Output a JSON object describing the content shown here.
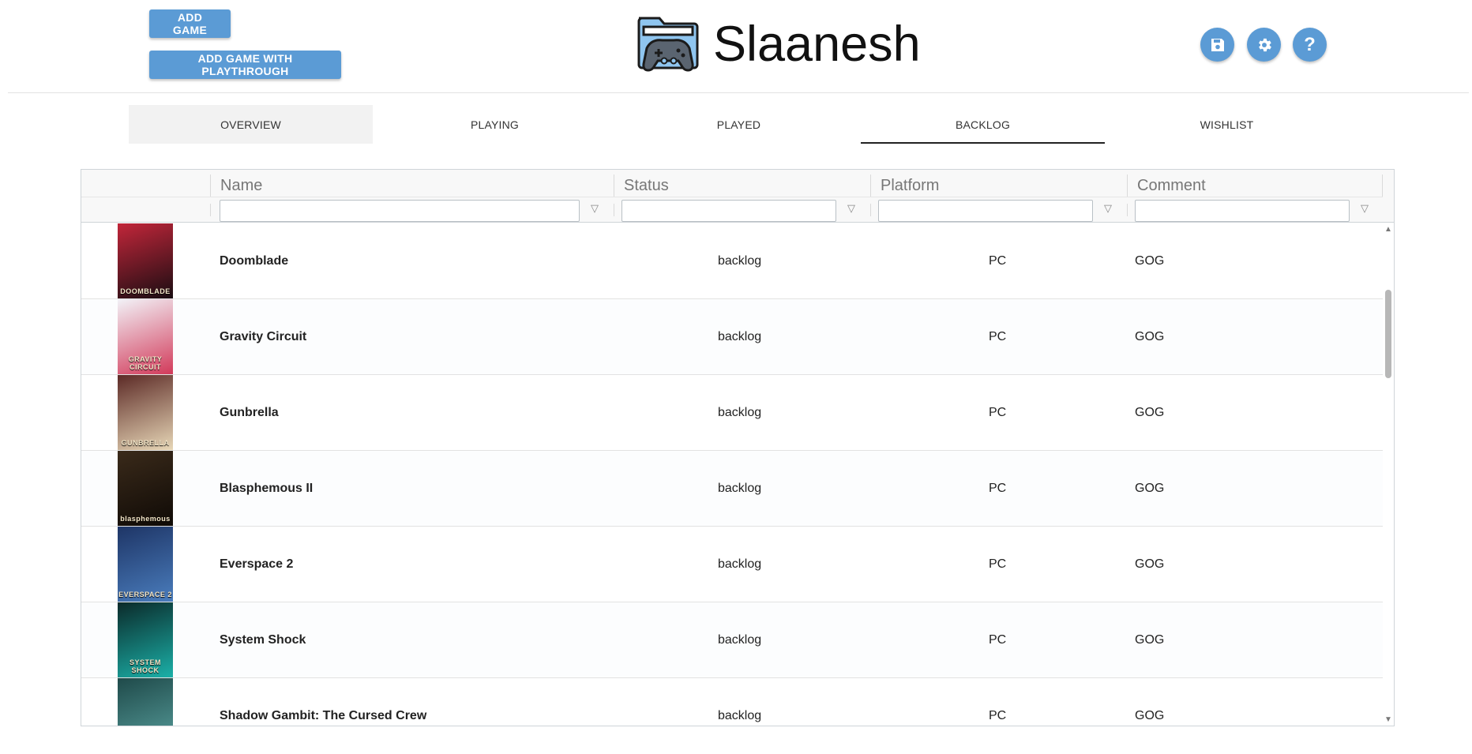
{
  "toolbar": {
    "add_game_label": "ADD GAME",
    "add_game_playthrough_label": "ADD GAME WITH PLAYTHROUGH"
  },
  "brand": {
    "title": "Slaanesh",
    "logo_icon": "folder-gamepad-icon"
  },
  "actions": {
    "save_icon": "save-icon",
    "settings_icon": "gear-icon",
    "help_label": "?"
  },
  "tabs": [
    {
      "label": "OVERVIEW"
    },
    {
      "label": "PLAYING"
    },
    {
      "label": "PLAYED"
    },
    {
      "label": "BACKLOG",
      "selected": true
    },
    {
      "label": "WISHLIST"
    }
  ],
  "grid": {
    "columns": [
      "Name",
      "Status",
      "Platform",
      "Comment"
    ],
    "rows": [
      {
        "name": "Doomblade",
        "status": "backlog",
        "platform": "PC",
        "comment": "GOG",
        "cover_colors": [
          "#c2263a",
          "#1a0d12"
        ],
        "cover_text": "DOOMBLADE"
      },
      {
        "name": "Gravity Circuit",
        "status": "backlog",
        "platform": "PC",
        "comment": "GOG",
        "cover_colors": [
          "#f2f2f7",
          "#d23a5a"
        ],
        "cover_text": "GRAVITY CIRCUIT"
      },
      {
        "name": "Gunbrella",
        "status": "backlog",
        "platform": "PC",
        "comment": "GOG",
        "cover_colors": [
          "#5c2a26",
          "#e7d7b7"
        ],
        "cover_text": "GUNBRELLA"
      },
      {
        "name": "Blasphemous II",
        "status": "backlog",
        "platform": "PC",
        "comment": "GOG",
        "cover_colors": [
          "#3a2a1a",
          "#0f0a06"
        ],
        "cover_text": "blasphemous"
      },
      {
        "name": "Everspace 2",
        "status": "backlog",
        "platform": "PC",
        "comment": "GOG",
        "cover_colors": [
          "#1e3566",
          "#4a7dbd"
        ],
        "cover_text": "EVERSPACE 2"
      },
      {
        "name": "System Shock",
        "status": "backlog",
        "platform": "PC",
        "comment": "GOG",
        "cover_colors": [
          "#0b2a2a",
          "#1bb0a8"
        ],
        "cover_text": "SYSTEM SHOCK"
      },
      {
        "name": "Shadow Gambit: The Cursed Crew",
        "status": "backlog",
        "platform": "PC",
        "comment": "GOG",
        "cover_colors": [
          "#1f4a4a",
          "#5aa2a0"
        ],
        "cover_text": ""
      }
    ]
  },
  "colors": {
    "accent": "#5b9bd5"
  }
}
